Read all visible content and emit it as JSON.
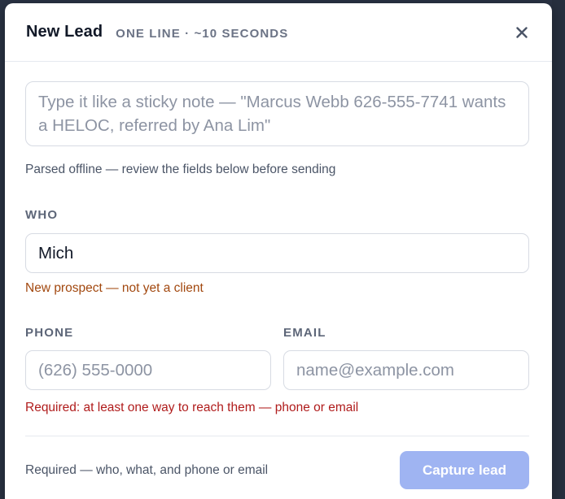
{
  "modal": {
    "title": "New Lead",
    "subtitle": "ONE LINE · ~10 SECONDS",
    "close_icon": "close-icon"
  },
  "quick_entry": {
    "value": "",
    "placeholder": "Type it like a sticky note — \"Marcus Webb 626-555-7741 wants a HELOC, referred by Ana Lim\"",
    "parse_note": "Parsed offline — review the fields below before sending"
  },
  "who": {
    "label": "WHO",
    "value": "Mich",
    "placeholder": "",
    "status": "New prospect — not yet a client"
  },
  "phone": {
    "label": "PHONE",
    "value": "",
    "placeholder": "(626) 555-0000"
  },
  "email": {
    "label": "EMAIL",
    "value": "",
    "placeholder": "name@example.com"
  },
  "contact_error": "Required: at least one way to reach them — phone or email",
  "footer": {
    "note": "Required — who, what, and phone or email",
    "capture_label": "Capture lead"
  },
  "colors": {
    "primary_disabled": "#9fb4f2",
    "warning_text": "#a2480f",
    "error_text": "#b01c1c"
  }
}
